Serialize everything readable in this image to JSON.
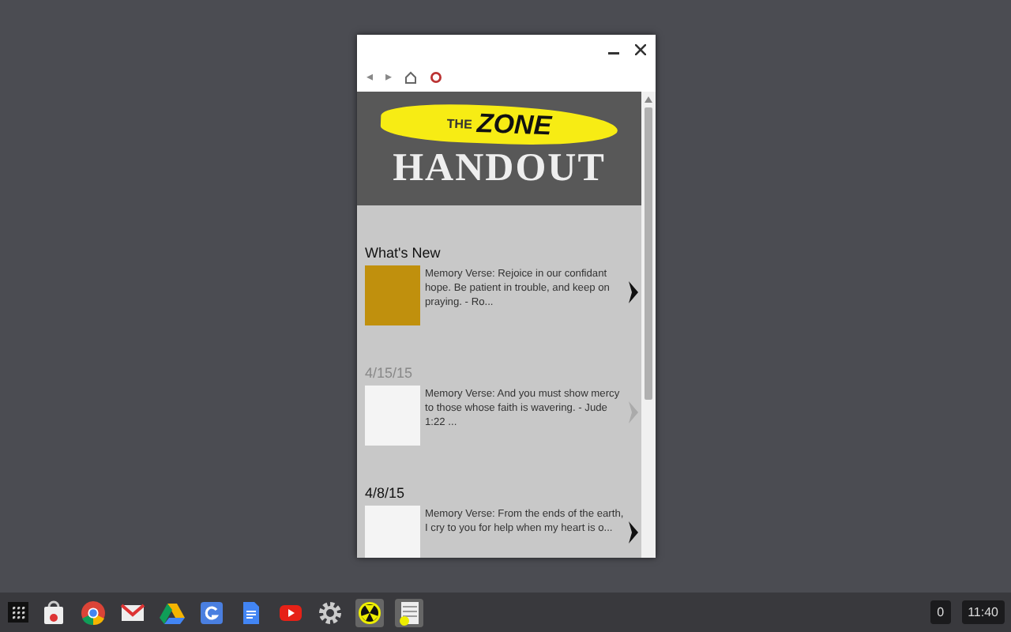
{
  "window": {
    "nav": [
      "◂",
      "▸"
    ],
    "banner": {
      "small": "THE",
      "big": "ZONE",
      "title": "HANDOUT"
    }
  },
  "sections": [
    {
      "heading": "What's New",
      "faded": false,
      "items": [
        {
          "color": "#c0900d",
          "text": "Memory Verse: Rejoice in our confidant hope. Be patient in trouble, and keep on praying. - Ro..."
        }
      ]
    },
    {
      "heading": "4/15/15",
      "faded": true,
      "items": [
        {
          "color": "#f4f4f4",
          "text": "Memory Verse: And you must show mercy to those whose faith is wavering. - Jude 1:22 ..."
        }
      ]
    },
    {
      "heading": "4/8/15",
      "faded": false,
      "items": [
        {
          "color": "#f4f4f4",
          "text": "Memory Verse: From the ends of the earth, I cry to you for help when my heart is o..."
        }
      ]
    }
  ],
  "taskbar": {
    "apps": [
      {
        "kind": "store"
      },
      {
        "kind": "chrome"
      },
      {
        "kind": "gmail"
      },
      {
        "kind": "drive"
      },
      {
        "kind": "gsearch"
      },
      {
        "kind": "docs"
      },
      {
        "kind": "youtube"
      },
      {
        "kind": "settings"
      },
      {
        "kind": "hazard"
      },
      {
        "kind": "app"
      }
    ],
    "notifications": "0",
    "time": "11:40"
  }
}
